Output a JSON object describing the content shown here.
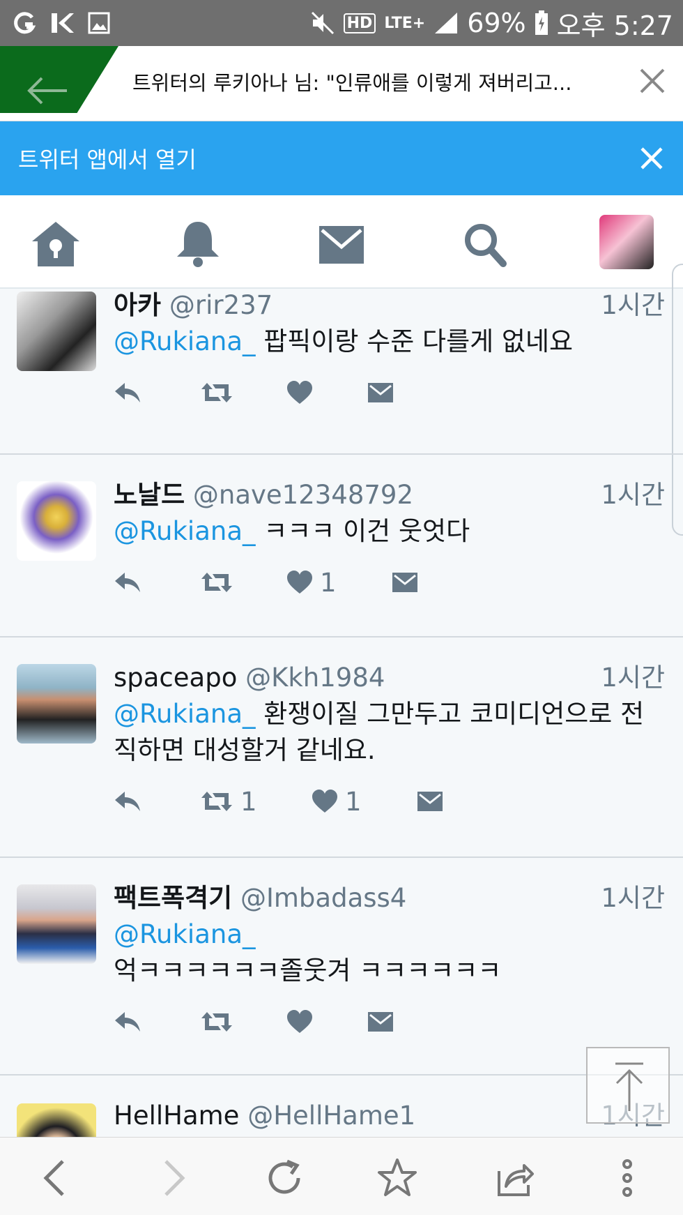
{
  "status_bar": {
    "network": "LTE+",
    "hd": "HD",
    "battery": "69%",
    "time": "오후 5:27"
  },
  "browser": {
    "page_title": "트위터의 루키아나 님: \"인류애를 이렇게 져버리고...",
    "tab_color": "#0b6b1c"
  },
  "app_banner": {
    "label": "트위터 앱에서 열기",
    "color": "#2aa3ef"
  },
  "nav": {
    "items": [
      "home-icon",
      "bell-icon",
      "envelope-icon",
      "search-icon",
      "profile-avatar"
    ]
  },
  "tweets": [
    {
      "name": "아카",
      "handle": "@rir237",
      "time": "1시간",
      "mention": "@Rukiana_",
      "text": " 팝픽이랑 수준 다를게 없네요",
      "retweets": "",
      "likes": ""
    },
    {
      "name": "노날드",
      "handle": "@nave12348792",
      "time": "1시간",
      "mention": "@Rukiana_",
      "text": " ㅋㅋㅋ 이건 웃엇다",
      "retweets": "",
      "likes": "1"
    },
    {
      "name": "spaceapo",
      "handle": "@Kkh1984",
      "time": "1시간",
      "mention": "@Rukiana_",
      "text": " 환쟁이질 그만두고 코미디언으로 전직하면 대성할거 같네요.",
      "retweets": "1",
      "likes": "1"
    },
    {
      "name": "팩트폭격기",
      "handle": "@Imbadass4",
      "time": "1시간",
      "mention": "@Rukiana_",
      "text": "억ㅋㅋㅋㅋㅋㅋ졸웃겨 ㅋㅋㅋㅋㅋㅋ",
      "retweets": "",
      "likes": ""
    },
    {
      "name": "HellHame",
      "handle": "@HellHame1",
      "time": "1시간",
      "mention": "",
      "text": "",
      "retweets": "",
      "likes": ""
    }
  ],
  "colors": {
    "mention": "#1b95e0",
    "secondary_text": "#657786",
    "feed_background": "#f5f8fa"
  }
}
